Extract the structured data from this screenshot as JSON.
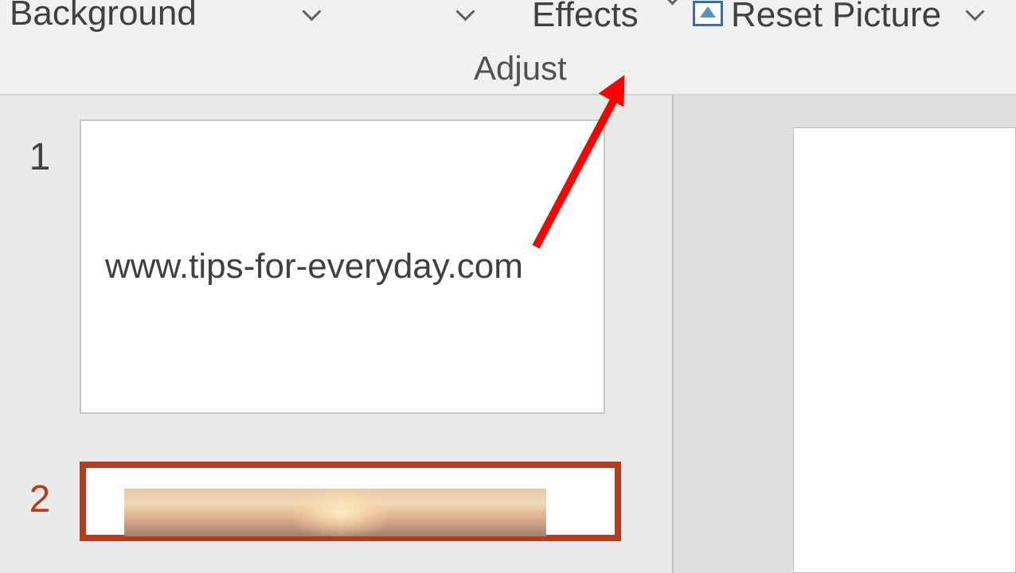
{
  "ribbon": {
    "background_label": "Background",
    "effects_label": "Effects",
    "reset_label": "Reset Picture",
    "group_label": "Adjust"
  },
  "slides": [
    {
      "number": "1",
      "text": "www.tips-for-everyday.com",
      "selected": false
    },
    {
      "number": "2",
      "text": "",
      "selected": true,
      "has_image": true
    }
  ],
  "colors": {
    "selected_border": "#b53d1f",
    "annotation_arrow": "#ff0000"
  }
}
